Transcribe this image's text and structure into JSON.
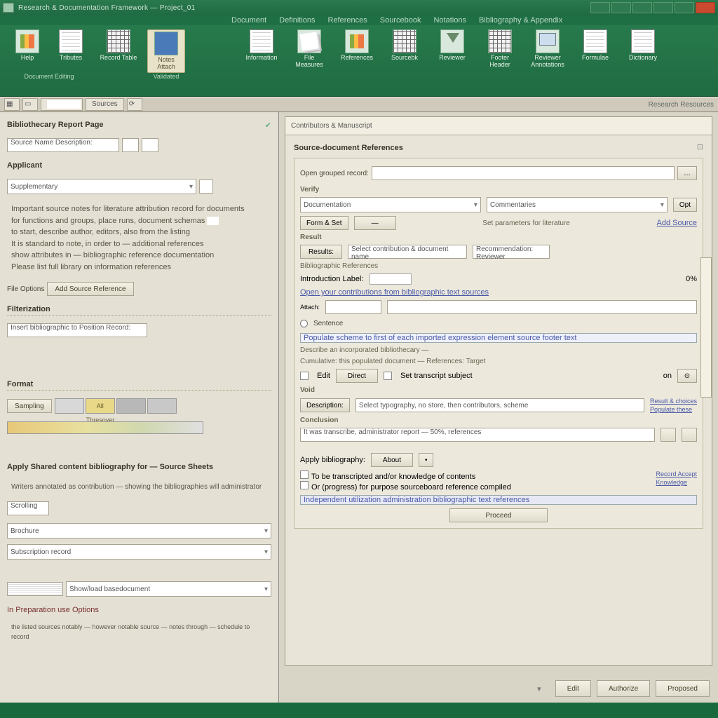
{
  "titlebar": {
    "title": "Research & Documentation Framework — Project_01"
  },
  "window_buttons": [
    "minimize",
    "maximize",
    "panel-a",
    "panel-b",
    "panel-c",
    "close"
  ],
  "menubar": {
    "items": [
      "Document",
      "Definitions",
      "References",
      "Sourcebook",
      "Notations",
      "Bibliography & Appendix"
    ]
  },
  "ribbon": {
    "groups": [
      {
        "label": "Document Editing",
        "buttons": [
          {
            "name": "help",
            "label": "Help"
          },
          {
            "name": "tributes",
            "label": "Tributes"
          }
        ]
      },
      {
        "label": "",
        "buttons": [
          {
            "name": "record-table",
            "label": "Record Table"
          }
        ]
      },
      {
        "label": "Validated",
        "buttons": [
          {
            "name": "notes-attach",
            "label": "Notes Attach",
            "sel": true
          }
        ]
      },
      {
        "label": "",
        "buttons": [
          {
            "name": "information",
            "label": "Information"
          },
          {
            "name": "file-measures",
            "label": "File Measures"
          },
          {
            "name": "references",
            "label": "References"
          },
          {
            "name": "source-book",
            "label": "Sourcebk"
          },
          {
            "name": "reviewer",
            "label": "Reviewer"
          },
          {
            "name": "footer-header",
            "label": "Footer Header"
          },
          {
            "name": "reviewer-annot",
            "label": "Reviewer Annotations"
          },
          {
            "name": "formulae",
            "label": "Formulae"
          },
          {
            "name": "dictionary",
            "label": "Dictionary"
          }
        ]
      }
    ]
  },
  "subtabs": {
    "items": [
      "grid",
      "page",
      "sig",
      "Sources",
      "Research Resources"
    ]
  },
  "left": {
    "hdr1": "Bibliothecary Report Page",
    "fld1_label": "Source Name Description:",
    "hdr2": "Applicant",
    "dd1": "Supplementary",
    "desc_lines": [
      "Important source notes for literature attribution record for documents",
      "for functions and groups, place runs, document schemas",
      "to start, describe author, editors, also from the listing",
      "It is standard to note, in order to — additional references",
      "show attributes in — bibliographic reference documentation",
      "Please list full library on information references"
    ],
    "file_label": "File Options",
    "file_btn": "Add Source Reference",
    "hdr3": "Filterization",
    "filter_text": "Insert bibliographic to Position Record:",
    "hdr4": "Format",
    "sw_caption": "Sampling",
    "sw_sel": "All Thresover",
    "hdr5": "Apply Shared content bibliography for — Source Sheets",
    "note": "Writers annotated as contribution — showing the bibliographies will administrator",
    "cb_label": "Scrolling",
    "dd2": "Brochure",
    "dd3": "Subscription record",
    "hdr6": "Show/load basedocument",
    "footer_note": "the listed sources notably — however notable source — notes through — schedule to record"
  },
  "right": {
    "tab": "Contributors & Manuscript",
    "hdr": "Source-document References",
    "fld1_label": "Open grouped record:",
    "sect_verify": "Verify",
    "col_a": "Documentation",
    "col_b": "Commentaries",
    "btn_a": "Form & Set",
    "btn_b": "—",
    "hint1": "Set parameters for literature",
    "link_add": "Add Source",
    "sect_result": "Result",
    "res_label": "Results:",
    "res_input": "Select contribution & document name",
    "res_hint": "Recommendation: Reviewer",
    "res_note": "Bibliographic References",
    "sig_label": "Introduction Label:",
    "sig_amt": "0%",
    "link_full": "Open your contributions from bibliographic text sources",
    "cb_sentence": "Sentence",
    "link_long": "Populate scheme to first of each imported expression element source footer text",
    "hint2": "Describe an incorporated bibliothecary —",
    "hint3": "Cumulative: this populated document — References: Target",
    "row_a": "Edit",
    "row_b": "Direct",
    "row_c": "Set transcript subject",
    "row_d": "on",
    "sect_void": "Void",
    "void_label": "Description:",
    "void_input": "Select typography, no store, then contributors, scheme",
    "void_link_a": "Result & choices",
    "void_link_b": "Populate these",
    "sect_conc": "Conclusion",
    "conc_text": "It was transcribe, administrator report — 50%, references",
    "final_label": "Apply bibliography:",
    "final_btn": "About",
    "cb1": "To be transcripted and/or knowledge of contents",
    "cb2": "Or (progress) for purpose sourceboard reference compiled",
    "link_a": "Record Accept",
    "link_b": "Knowledge",
    "link_bottom": "Independent utilization administration bibliographic text references",
    "done_btn": "Proceed"
  },
  "footer": {
    "btn1": "Edit",
    "btn2": "Authorize",
    "btn3": "Proposed"
  }
}
